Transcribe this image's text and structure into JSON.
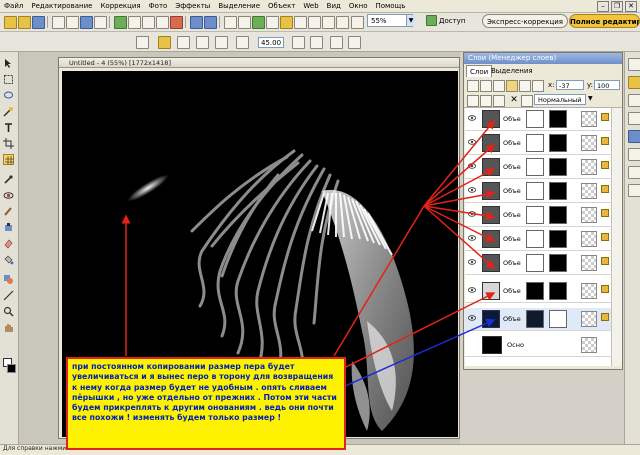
{
  "menu": {
    "items": [
      "Файл",
      "Редактирование",
      "Коррекция",
      "Фото",
      "Эффекты",
      "Выделение",
      "Объект",
      "Web",
      "Вид",
      "Окно",
      "Помощь"
    ]
  },
  "toolbar": {
    "zoom": "55%",
    "access_label": "Доступ",
    "express_label": "Экспресс-коррекция",
    "full_label": "Полное редактиров...",
    "angle_value": "45.00"
  },
  "document": {
    "title": "Untitled - 4 (55%) [1772x1418]"
  },
  "layers_panel": {
    "title": "Слои (Менеджер слоев)",
    "tabs": [
      "Слои",
      "Выделения"
    ],
    "x_label": "x:",
    "x_value": "-37",
    "y_label": "y:",
    "y_value": "100",
    "blend_mode": "Нормальный",
    "layers": [
      {
        "name": "Объе"
      },
      {
        "name": "Объе"
      },
      {
        "name": "Объе"
      },
      {
        "name": "Объе"
      },
      {
        "name": "Объе"
      },
      {
        "name": "Объе"
      },
      {
        "name": "Объе"
      },
      {
        "name": "Объе"
      },
      {
        "name": "Объе"
      },
      {
        "name": "Осно"
      }
    ]
  },
  "status": {
    "text": "Для справки нажмите"
  },
  "note": {
    "text": "при постоянном копировании размер пера будет увеличиваться и я вынес перо в торону для возвращения к нему когда размер будет не удобным . опять сливаем пёрышки , но уже отдельно от прежних . Потом эти части будем прикреплять к другим онованиям . ведь они почти все похожи ! изменять будем только размер !"
  },
  "colors": {
    "note_bg": "#fff200",
    "note_text": "#001fb6",
    "arrow_red": "#e2231a",
    "arrow_blue": "#1a2bd8",
    "canvas_bg": "#000000"
  }
}
